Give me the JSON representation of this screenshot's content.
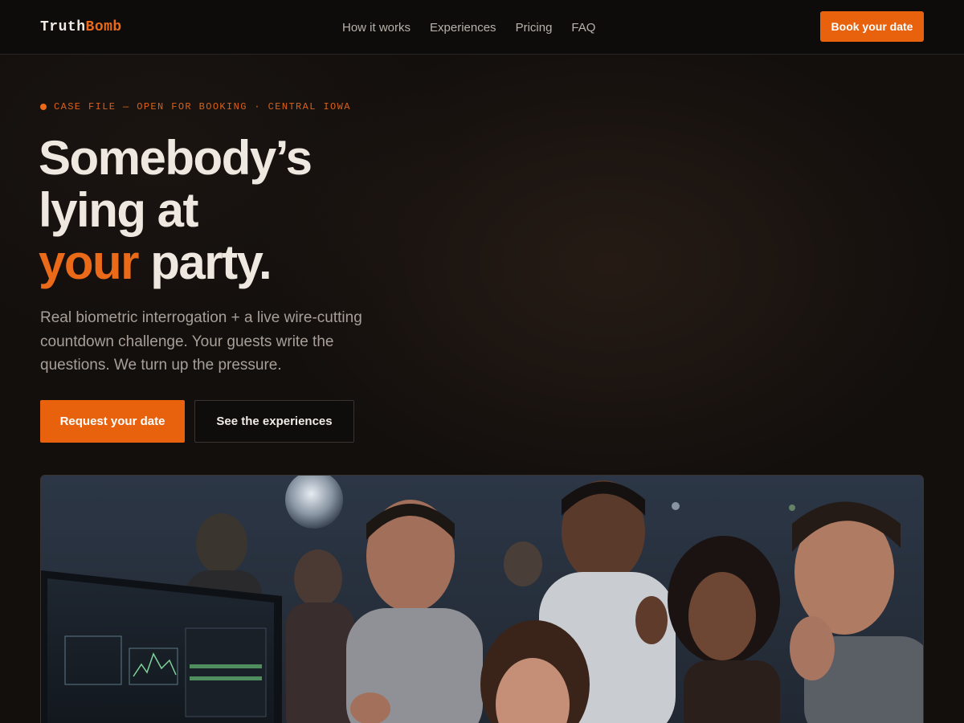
{
  "nav": {
    "logo_part1": "Truth",
    "logo_part2": "Bomb",
    "links": [
      "How it works",
      "Experiences",
      "Pricing",
      "FAQ"
    ],
    "cta_label": "Book your date"
  },
  "hero": {
    "eyebrow": "CASE FILE — OPEN FOR BOOKING · CENTRAL IOWA",
    "headline_line1": "Somebody’s",
    "headline_line2": "lying at",
    "headline_accent": "your",
    "headline_end": " party.",
    "lede": "Real biometric interrogation + a live wire-cutting countdown challenge. Your guests write the questions. We turn up the pressure.",
    "primary_cta": "Request your date",
    "secondary_cta": "See the experiences"
  },
  "colors": {
    "accent": "#e8620e",
    "background": "#120f0d",
    "nav_background": "#0d0c0b",
    "text_primary": "#efe8e1",
    "text_muted": "#a79f98"
  }
}
